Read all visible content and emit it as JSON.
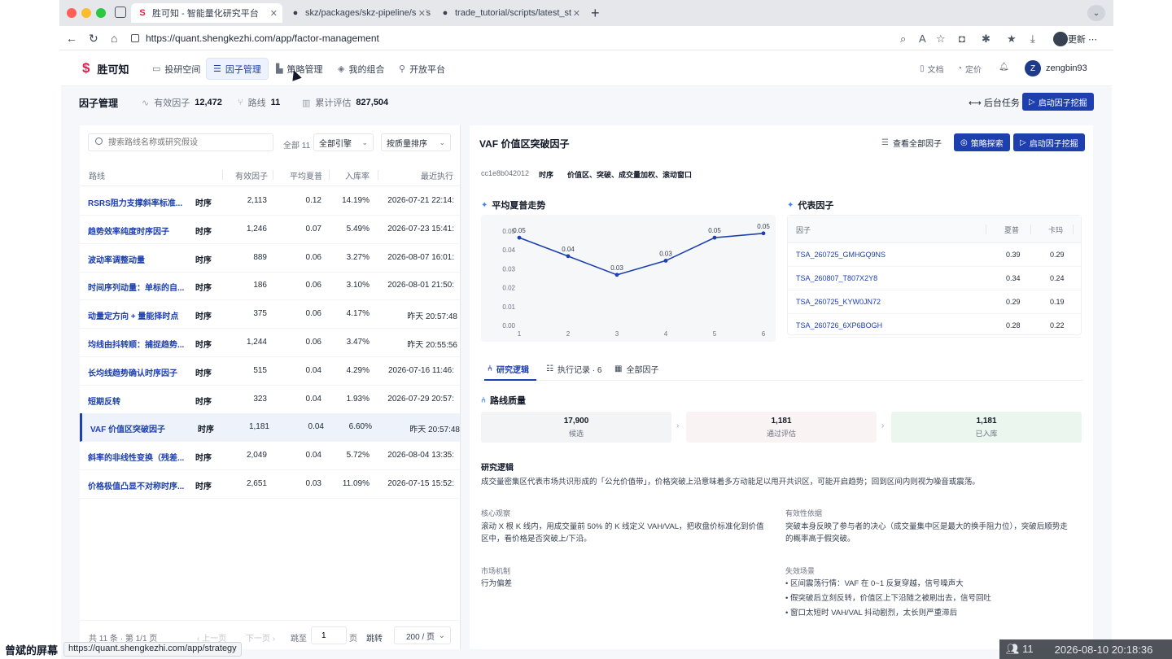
{
  "browser": {
    "tabs": [
      {
        "title": "胜可知 - 智能量化研究平台",
        "favicon": "S"
      },
      {
        "title": "skz/packages/skz-pipeline/src/s",
        "favicon": "github-icon"
      },
      {
        "title": "trade_tutorial/scripts/latest_stra",
        "favicon": "github-icon"
      }
    ],
    "url": "https://quant.shengkezhi.com/app/factor-management",
    "update_label": "更新",
    "colors": {
      "red": "#ff5f57",
      "yellow": "#febc2e",
      "green": "#28c840"
    }
  },
  "app": {
    "logo": "胜可知",
    "nav": [
      {
        "label": "投研空间",
        "icon": "chat-icon"
      },
      {
        "label": "因子管理",
        "icon": "database-icon"
      },
      {
        "label": "策略管理",
        "icon": "bar-chart-icon"
      },
      {
        "label": "我的组合",
        "icon": "cube-icon"
      },
      {
        "label": "开放平台",
        "icon": "link-icon"
      }
    ],
    "top_right": {
      "docs": "文档",
      "pricing": "定价",
      "user_initial": "Z",
      "username": "zengbin93"
    },
    "accent": "#1e40af"
  },
  "subheader": {
    "title": "因子管理",
    "stats": [
      {
        "label": "有效因子",
        "value": "12,472"
      },
      {
        "label": "路线",
        "value": "11"
      },
      {
        "label": "累计评估",
        "value": "827,504"
      }
    ],
    "bg_task": "后台任务",
    "start_mining": "启动因子挖掘"
  },
  "left": {
    "search_placeholder": "搜索路线名称或研究假设",
    "total": "全部 11",
    "engine_select": "全部引擎",
    "sort_select": "按质量排序",
    "columns": [
      "路线",
      "有效因子",
      "平均夏普",
      "入库率",
      "最近执行"
    ],
    "rows": [
      {
        "name": "RSRS阻力支撑斜率标准...",
        "type": "时序",
        "count": "2,113",
        "sharpe": "0.12",
        "rate": "14.19%",
        "last": "2026-07-21 22:14:"
      },
      {
        "name": "趋势效率纯度时序因子",
        "type": "时序",
        "count": "1,246",
        "sharpe": "0.07",
        "rate": "5.49%",
        "last": "2026-07-23 15:41:"
      },
      {
        "name": "波动率调整动量",
        "type": "时序",
        "count": "889",
        "sharpe": "0.06",
        "rate": "3.27%",
        "last": "2026-08-07 16:01:"
      },
      {
        "name": "时间序列动量：单标的自...",
        "type": "时序",
        "count": "186",
        "sharpe": "0.06",
        "rate": "3.10%",
        "last": "2026-08-01 21:50:"
      },
      {
        "name": "动量定方向 + 量能择时点",
        "type": "时序",
        "count": "375",
        "sharpe": "0.06",
        "rate": "4.17%",
        "last": "昨天 20:57:48"
      },
      {
        "name": "均线由抖转顺：捕捉趋势...",
        "type": "时序",
        "count": "1,244",
        "sharpe": "0.06",
        "rate": "3.47%",
        "last": "昨天 20:55:56"
      },
      {
        "name": "长均线趋势确认时序因子",
        "type": "时序",
        "count": "515",
        "sharpe": "0.04",
        "rate": "4.29%",
        "last": "2026-07-16 11:46:"
      },
      {
        "name": "短期反转",
        "type": "时序",
        "count": "323",
        "sharpe": "0.04",
        "rate": "1.93%",
        "last": "2026-07-29 20:57:"
      },
      {
        "name": "VAF 价值区突破因子",
        "type": "时序",
        "count": "1,181",
        "sharpe": "0.04",
        "rate": "6.60%",
        "last": "昨天 20:57:48"
      },
      {
        "name": "斜率的非线性变换（残差...",
        "type": "时序",
        "count": "2,049",
        "sharpe": "0.04",
        "rate": "5.72%",
        "last": "2026-08-04 13:35:"
      },
      {
        "name": "价格极值凸显不对称时序...",
        "type": "时序",
        "count": "2,651",
        "sharpe": "0.03",
        "rate": "11.09%",
        "last": "2026-07-15 15:52:"
      }
    ],
    "pager": {
      "summary": "共 11 条 · 第 1/1 页",
      "prev": "上一页",
      "next": "下一页",
      "jump_label": "跳至",
      "page_value": "1",
      "page_unit": "页",
      "go": "跳转",
      "page_size": "200 / 页"
    }
  },
  "right": {
    "title": "VAF 价值区突破因子",
    "actions": {
      "view_all": "查看全部因子",
      "strategy_explore": "策略探索",
      "start_mining": "启动因子挖掘"
    },
    "meta": {
      "hash": "cc1e8b042012",
      "type": "时序",
      "tags": "价值区、突破、成交量加权、滚动窗口"
    },
    "trend_title": "平均夏普走势",
    "rep_title": "代表因子",
    "rep_columns": [
      "因子",
      "夏普",
      "卡玛"
    ],
    "rep_rows": [
      {
        "id": "TSA_260725_GMHGQ9NS",
        "sharpe": "0.39",
        "calmar": "0.29"
      },
      {
        "id": "TSA_260807_T807X2Y8",
        "sharpe": "0.34",
        "calmar": "0.24"
      },
      {
        "id": "TSA_260725_KYW0JN72",
        "sharpe": "0.29",
        "calmar": "0.19"
      },
      {
        "id": "TSA_260726_6XP6BOGH",
        "sharpe": "0.28",
        "calmar": "0.22"
      }
    ],
    "tabs": [
      {
        "label": "研究逻辑",
        "icon": "tree-icon"
      },
      {
        "label": "执行记录 · 6",
        "icon": "list-icon"
      },
      {
        "label": "全部因子",
        "icon": "table-icon"
      }
    ],
    "quality_title": "路线质量",
    "quality": [
      {
        "value": "17,900",
        "label": "候选",
        "color": "#f3f4f6"
      },
      {
        "value": "1,181",
        "label": "通过评估",
        "color": "#f9f3f3"
      },
      {
        "value": "1,181",
        "label": "已入库",
        "color": "#eaf6ee"
      }
    ],
    "logic_title": "研究逻辑",
    "logic_text": "成交量密集区代表市场共识形成的「公允价值带」，价格突破上沿意味着多方动能足以甩开共识区，可能开启趋势；回到区间内则视为噪音或震荡。",
    "core_label": "核心观察",
    "core_text_1": "滚动 X 根 K 线内，用成交量前 50% 的 K 线定义 VAH/VAL，把收盘价标准化到价值",
    "core_text_2": "区中，看价格是否突破上/下沿。",
    "valid_label": "有效性依据",
    "valid_text_1": "突破本身反映了参与者的决心（成交量集中区是最大的换手阻力位），突破后顺势走",
    "valid_text_2": "的概率高于假突破。",
    "mech_label": "市场机制",
    "mech_text": "行为偏差",
    "fail_label": "失效场景",
    "fail_items": [
      "区间震荡行情：VAF 在 0~1 反复穿越，信号噪声大",
      "假突破后立刻反转，价值区上下沿随之被刷出去，信号回吐",
      "窗口太短时 VAH/VAL 抖动剧烈，太长则严重滞后"
    ]
  },
  "chart_data": {
    "type": "line",
    "title": "平均夏普走势",
    "x": [
      1,
      2,
      3,
      4,
      5,
      6
    ],
    "series": [
      {
        "values": [
          0.05,
          0.04,
          0.03,
          0.03,
          0.05,
          0.05
        ]
      }
    ],
    "point_labels": [
      "0.05",
      "0.04",
      "0.03",
      "0.03",
      "0.05",
      "0.05"
    ],
    "y_ticks": [
      "0.00",
      "0.01",
      "0.02",
      "0.03",
      "0.04",
      "0.05"
    ],
    "x_ticks": [
      "1",
      "2",
      "3",
      "4",
      "5",
      "6"
    ],
    "ylim": [
      0,
      0.05
    ],
    "plot_values": [
      0.0465,
      0.0367,
      0.0268,
      0.0343,
      0.0465,
      0.0488
    ],
    "color": "#1e40af",
    "grid": false
  },
  "overlays": {
    "status_url": "https://quant.shengkezhi.com/app/strategy",
    "screen_label": "曾斌的屏幕",
    "participants": "11",
    "datetime": "2026-08-10 20:18:36"
  }
}
